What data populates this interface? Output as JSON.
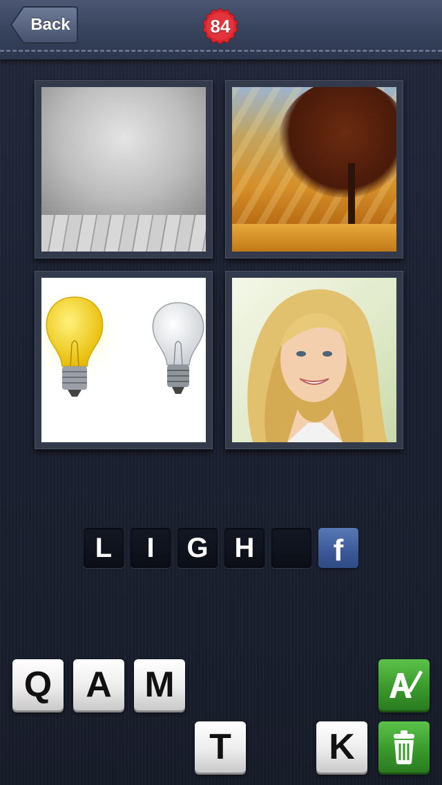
{
  "header": {
    "back_label": "Back",
    "level": "84"
  },
  "puzzle": {
    "pictures": [
      {
        "name": "empty grey room"
      },
      {
        "name": "autumn forest with sun rays"
      },
      {
        "name": "two light bulbs"
      },
      {
        "name": "smiling blonde woman"
      }
    ]
  },
  "answer": {
    "slots": [
      "L",
      "I",
      "G",
      "H",
      ""
    ],
    "share_label": "f"
  },
  "keyboard": {
    "keys": [
      "Q",
      "A",
      "M",
      "T",
      "K"
    ]
  },
  "colors": {
    "badge": "#d9262e",
    "tool_green": "#3a9a2c",
    "facebook": "#3b5998"
  },
  "icons": {
    "reveal": "pencil-a-icon",
    "remove": "trash-icon"
  }
}
